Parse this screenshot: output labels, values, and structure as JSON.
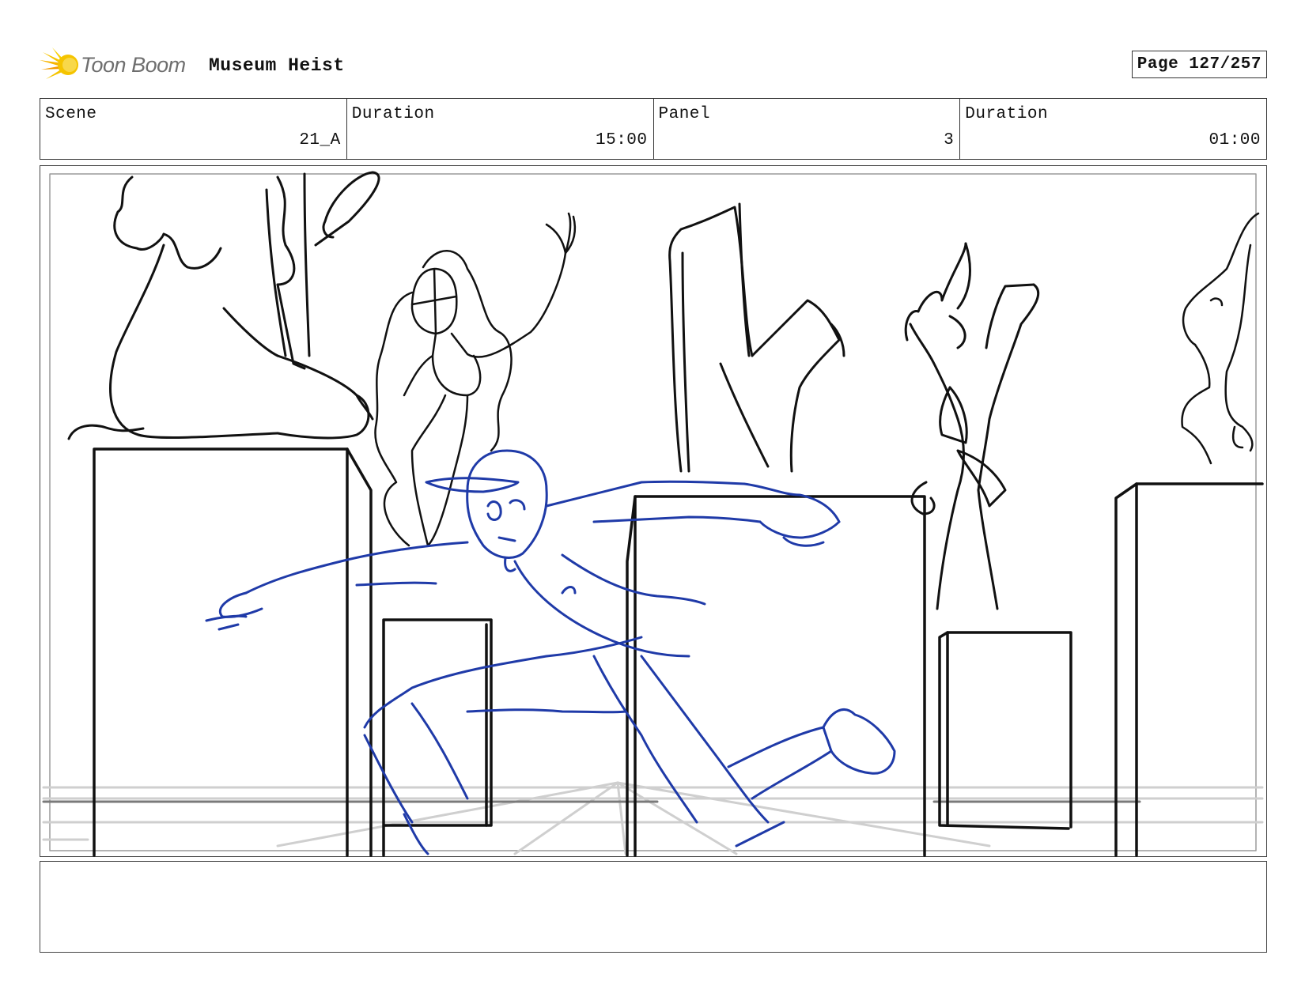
{
  "header": {
    "logo_text": "Toon Boom",
    "project_title": "Museum Heist",
    "page_label": "Page 127/257"
  },
  "info": {
    "scene_label": "Scene",
    "scene_value": "21_A",
    "scene_duration_label": "Duration",
    "scene_duration_value": "15:00",
    "panel_label": "Panel",
    "panel_value": "3",
    "panel_duration_label": "Duration",
    "panel_duration_value": "01:00"
  },
  "colors": {
    "sketch_black": "#111111",
    "sketch_blue": "#1f3aa8",
    "floor_grey": "#c8c8c8",
    "logo_yellow": "#f5c400",
    "logo_orange": "#f39a00"
  },
  "notes": {
    "text": ""
  }
}
